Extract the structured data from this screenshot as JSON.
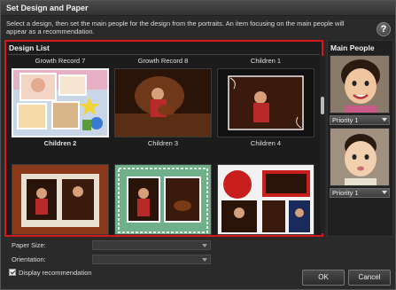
{
  "window": {
    "title": "Set Design and Paper"
  },
  "instruction": "Select a design, then set the main people for the design from the portraits. An item focusing on the main people will appear as a recommendation.",
  "help_icon": "question-mark-icon",
  "design_list": {
    "heading": "Design List",
    "selected_index": 0,
    "items": [
      {
        "title": "Growth Record 7",
        "below": "Children 2"
      },
      {
        "title": "Growth Record 8",
        "below": "Children 3"
      },
      {
        "title": "Children 1",
        "below": "Children 4"
      },
      {
        "title": ""
      },
      {
        "title": ""
      },
      {
        "title": ""
      }
    ]
  },
  "main_people": {
    "heading": "Main People",
    "people": [
      {
        "priority": "Priority 1"
      },
      {
        "priority": "Priority 1"
      }
    ]
  },
  "paper": {
    "size_label": "Paper Size:",
    "size_value": "",
    "orientation_label": "Orientation:",
    "orientation_value": ""
  },
  "display_recommendation": {
    "label": "Display recommendation",
    "checked": true
  },
  "buttons": {
    "ok": "OK",
    "cancel": "Cancel"
  },
  "colors": {
    "highlight": "#d81818",
    "background": "#2a2a2a"
  }
}
